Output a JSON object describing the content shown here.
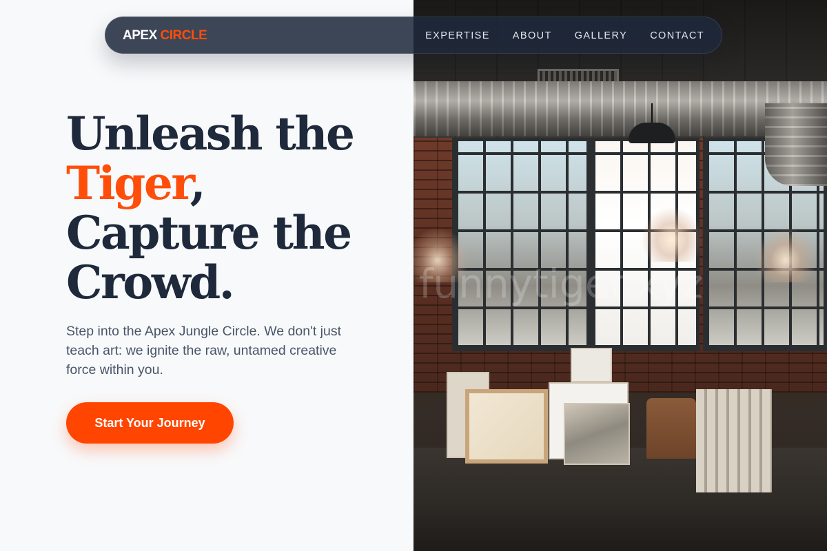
{
  "navbar": {
    "brand_primary": "APEX",
    "brand_accent": "CIRCLE",
    "links": [
      {
        "label": "EXPERTISE"
      },
      {
        "label": "ABOUT"
      },
      {
        "label": "GALLERY"
      },
      {
        "label": "CONTACT"
      }
    ]
  },
  "hero": {
    "headline_line1": "Unleash the",
    "headline_accent": "Tiger",
    "headline_comma": ",",
    "headline_line3": "Capture the",
    "headline_line4": "Crowd.",
    "lede": "Step into the Apex Jungle Circle. We don't just teach art: we ignite the raw, untamed creative force within you.",
    "cta_label": "Start Your Journey"
  },
  "image": {
    "watermark": "funnytiger.xyz"
  },
  "colors": {
    "accent": "#ff4500",
    "heading": "#1e293b",
    "body_text": "#475569",
    "navbar_bg": "#1e293b",
    "page_bg": "#f8f9fa"
  }
}
